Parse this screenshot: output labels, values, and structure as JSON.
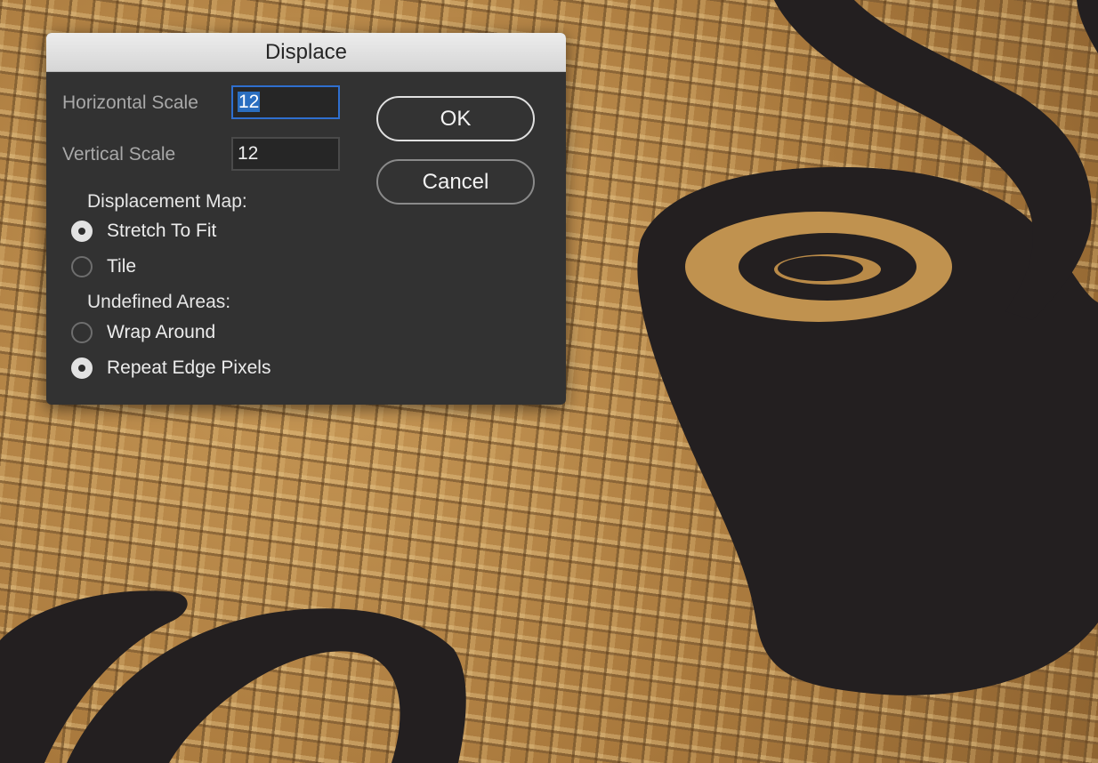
{
  "dialog": {
    "title": "Displace",
    "horizontal_scale": {
      "label": "Horizontal Scale",
      "value": "12",
      "focused": true
    },
    "vertical_scale": {
      "label": "Vertical Scale",
      "value": "12"
    },
    "ok_label": "OK",
    "cancel_label": "Cancel",
    "displacement_map": {
      "heading": "Displacement Map:",
      "options": [
        {
          "label": "Stretch To Fit",
          "checked": true
        },
        {
          "label": "Tile",
          "checked": false
        }
      ]
    },
    "undefined_areas": {
      "heading": "Undefined Areas:",
      "options": [
        {
          "label": "Wrap Around",
          "checked": false
        },
        {
          "label": "Repeat Edge Pixels",
          "checked": true
        }
      ]
    }
  },
  "canvas": {
    "background": "burlap-texture",
    "artwork": "coffee-cup-logo",
    "shape_color": "#231f20"
  }
}
